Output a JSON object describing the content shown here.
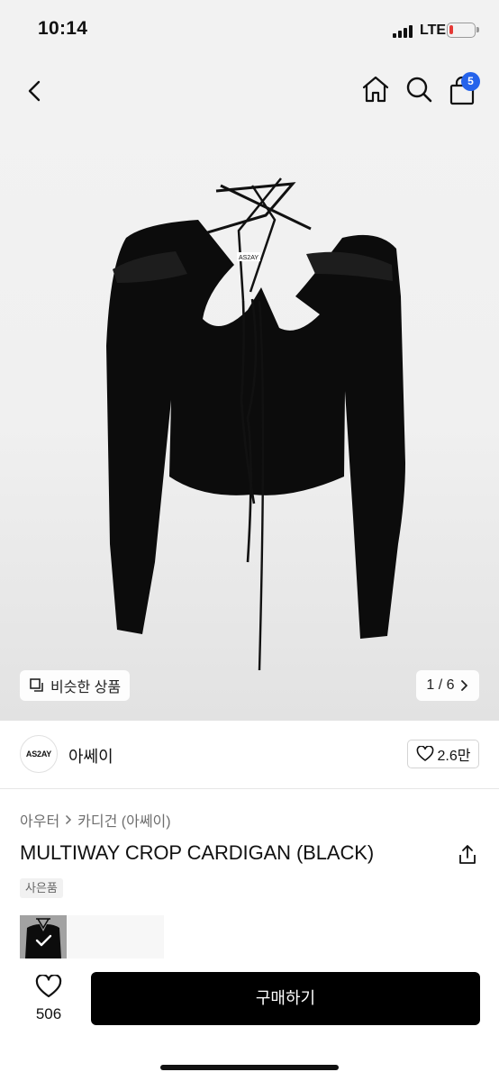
{
  "status": {
    "time": "10:14",
    "network": "LTE"
  },
  "header": {
    "back_icon": "chevron-left-icon",
    "home_icon": "home-icon",
    "search_icon": "search-icon",
    "cart_icon": "shopping-bag-icon",
    "cart_count": "5",
    "badge_color": "#2563eb"
  },
  "gallery": {
    "similar_label": "비슷한 상품",
    "pager": "1 / 6",
    "garment_tag": "AS2AY"
  },
  "brand": {
    "logo_text": "AS2AY",
    "name": "아쎄이",
    "likes": "2.6만"
  },
  "product": {
    "breadcrumb": [
      "아우터",
      "카디건 (아쎄이)"
    ],
    "title": "MULTIWAY CROP CARDIGAN (BLACK)",
    "tag": "사은품"
  },
  "bottom": {
    "wish_count": "506",
    "buy_label": "구매하기",
    "buy_color": "#000000"
  }
}
